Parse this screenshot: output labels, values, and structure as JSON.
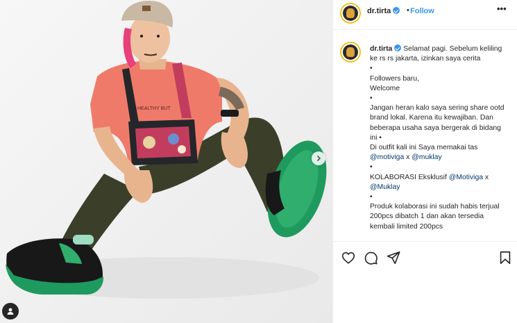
{
  "post": {
    "username": "dr.tirta",
    "follow_label": "Follow",
    "more_label": "•••",
    "separator": "•"
  },
  "caption": {
    "username": "dr.tirta",
    "lines": [
      {
        "t": "Selamat pagi. Sebelum keliling ke rs rs jakarta, izinkan saya cerita"
      },
      {
        "t": "•"
      },
      {
        "t": "Followers baru,"
      },
      {
        "t": "Welcome"
      },
      {
        "t": "•"
      },
      {
        "t": "Jangan heran kalo saya sering share ootd brand lokal. Karena itu kewajiban. Dan beberapa usaha saya bergerak di bidang ini •"
      },
      {
        "t": "Di outfit kali ini Saya memakai tas"
      },
      {
        "m1": "@motiviga",
        "mid": " x ",
        "m2": "@muklay"
      },
      {
        "t": "•"
      },
      {
        "t": "KOLABORASI Eksklusif ",
        "m1": "@Motiviga",
        "mid": " x ",
        "m2": "@Muklay"
      },
      {
        "t": "•"
      },
      {
        "t": "Produk kolaborasi ini sudah habis terjual 200pcs dibatch 1 dan akan tersedia kembali limited 200pcs"
      }
    ]
  },
  "photo": {
    "shirt_text": "HEALTHY BUT"
  },
  "colors": {
    "accent": "#3897f0",
    "mention": "#00376b",
    "shirt": "#ef7a6a",
    "pants": "#3b3f2a",
    "sole": "#1f9a5e"
  },
  "icons": {
    "like": "heart-icon",
    "comment": "comment-icon",
    "share": "share-icon",
    "save": "bookmark-icon",
    "next": "chevron-right-icon",
    "tag": "user-tag-icon"
  }
}
